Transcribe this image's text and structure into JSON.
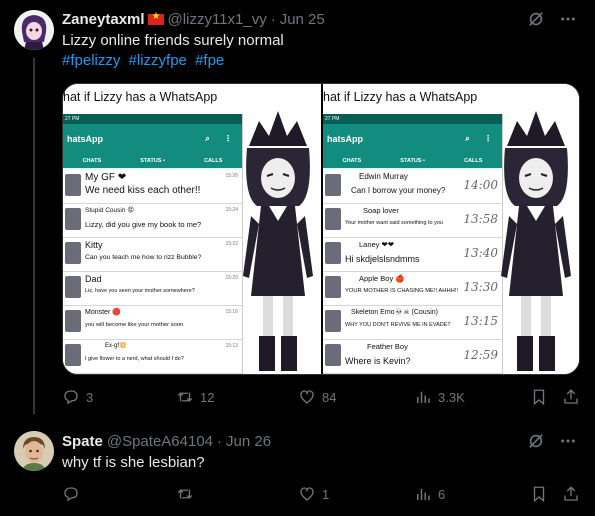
{
  "tweet1": {
    "display_name": "Zaneytaxml",
    "handle": "@lizzy11x1_vy",
    "separator": "·",
    "date": "Jun 25",
    "text": "Lizzy online friends surely normal",
    "hashtags": [
      "#fpelizzy",
      "#lizzyfpe",
      "#fpe"
    ],
    "media": {
      "left": {
        "title": "hat if Lizzy has a WhatsApp",
        "app_title": "hatsApp",
        "status_time": "27 PM",
        "tabs": [
          "CHATS",
          "STATUS •",
          "CALLS"
        ],
        "chats": [
          {
            "name": "My GF ❤",
            "message": "We need kiss each other!!",
            "time": "15:26"
          },
          {
            "name": "Stupid Cousin 😡",
            "message": "Lizzy, did you give my book to me?",
            "time": "15:24"
          },
          {
            "name": "Kitty",
            "message": "Can you teach me how to rizz Bubble?",
            "time": "15:22"
          },
          {
            "name": "Dad",
            "message": "Liz, have you seen your mother somewhere?",
            "time": "15:20"
          },
          {
            "name": "Monster 🔴",
            "message": "you will become like your mother soon",
            "time": "15:16"
          },
          {
            "name": "Ex-gf💥",
            "message": "I give flower to a nerd, what should I do?",
            "time": "15:13"
          }
        ]
      },
      "right": {
        "title": "hat if Lizzy has a WhatsApp",
        "app_title": "hatsApp",
        "status_time": "27 PM",
        "tabs": [
          "CHATS",
          "STATUS •",
          "CALLS"
        ],
        "chats": [
          {
            "name": "Edwin Murray",
            "message": "Can I borrow your money?",
            "time": "14:00"
          },
          {
            "name": "Soap lover",
            "message": "Your mother want said something to you",
            "time": "13:58"
          },
          {
            "name": "Laney ❤❤",
            "message": "Hi skdjelslsndmms",
            "time": "13:40"
          },
          {
            "name": "Apple Boy 🍎",
            "message": "YOUR MOTHER IS CHASING ME!! AHHH!!",
            "time": "13:30"
          },
          {
            "name": "Skeleton Emo💀☠ (Cousin)",
            "message": "WHY YOU DON'T REVIVE ME IN EVADE?",
            "time": "13:15"
          },
          {
            "name": "Feather Boy",
            "message": "Where is Kevin?",
            "time": "12:59"
          }
        ]
      }
    },
    "actions": {
      "replies": "3",
      "retweets": "12",
      "likes": "84",
      "views": "3.3K"
    }
  },
  "tweet2": {
    "display_name": "Spate",
    "handle": "@SpateA64104",
    "separator": "·",
    "date": "Jun 26",
    "text": "why tf is she lesbian?",
    "actions": {
      "replies": "",
      "retweets": "",
      "likes": "1",
      "views": "6"
    }
  },
  "colors": {
    "background": "#000000",
    "link": "#1d9bf0",
    "muted": "#71767b",
    "whatsapp_green": "#128c7e"
  },
  "icons": [
    "grok-icon",
    "more-icon",
    "reply-icon",
    "retweet-icon",
    "like-icon",
    "views-icon",
    "bookmark-icon",
    "share-icon"
  ]
}
